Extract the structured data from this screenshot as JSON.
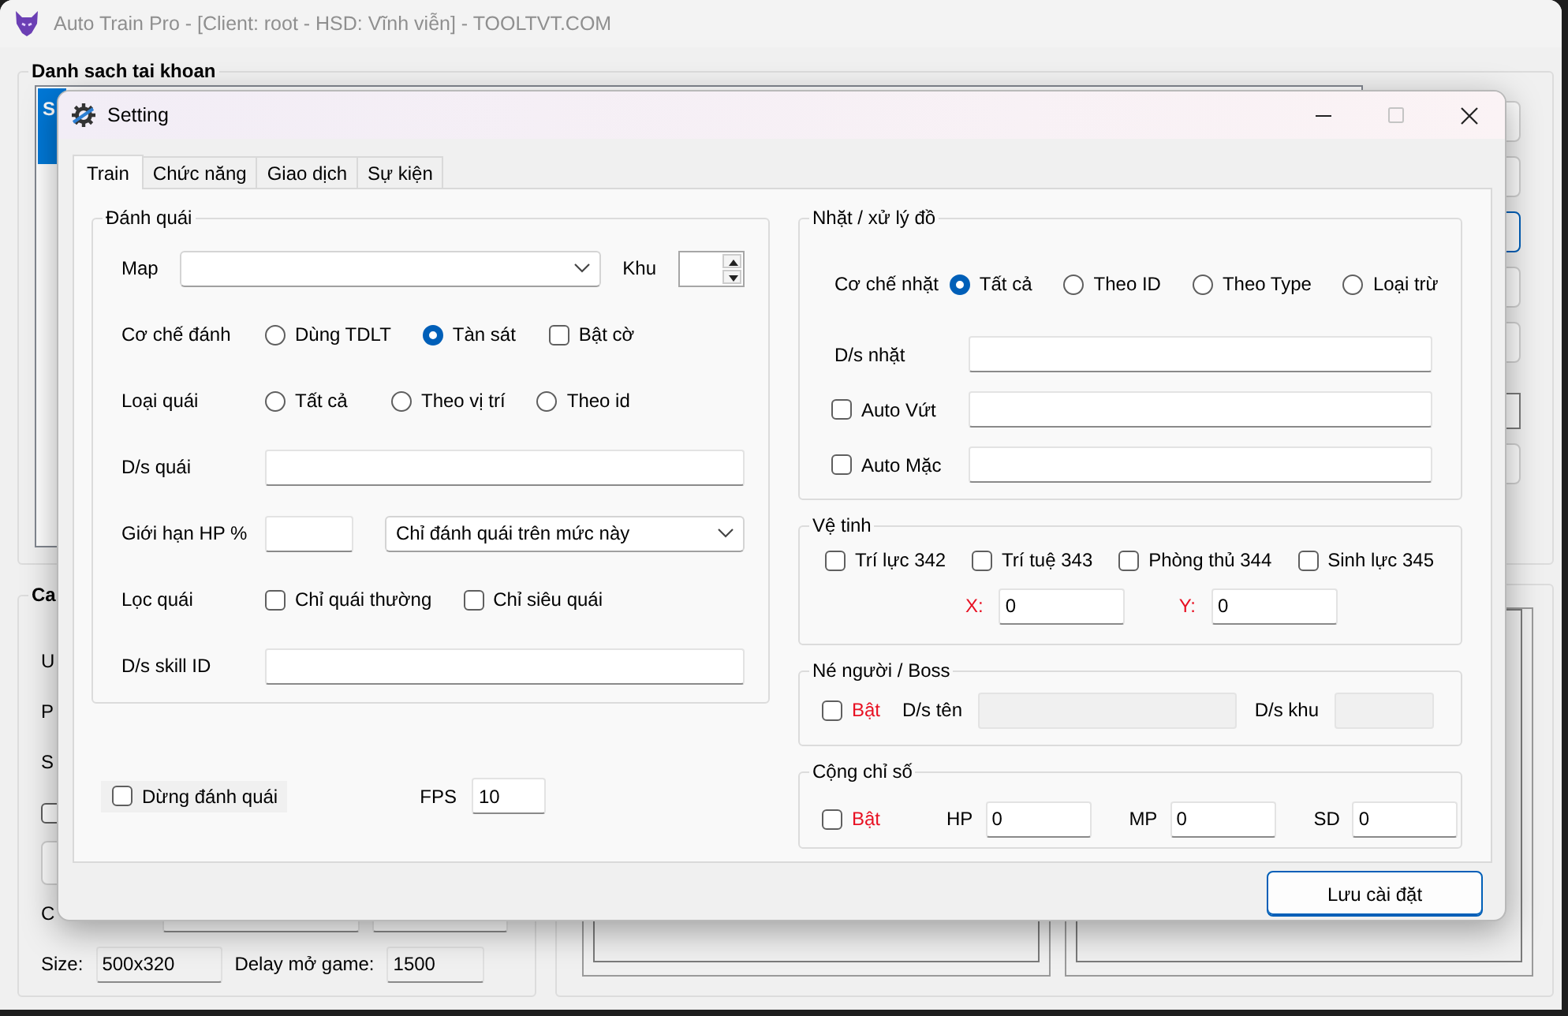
{
  "main_window": {
    "title": "Auto Train Pro - [Client: root - HSD: Vĩnh viễn] - TOOLTVT.COM",
    "accounts": {
      "title": "Danh sach tai khoan",
      "list_header": "S"
    },
    "config": {
      "title": "Ca",
      "labels": [
        "U",
        "P",
        "S",
        "C"
      ],
      "checkbox": {
        "checked": false
      },
      "size_label": "Size:",
      "size_value": "500x320",
      "delay_label": "Delay mở game:",
      "delay_value": "1500"
    }
  },
  "dialog": {
    "title": "Setting",
    "window_buttons": [
      {
        "kind": "minimize",
        "disabled": false
      },
      {
        "kind": "maximize",
        "disabled": true
      },
      {
        "kind": "close",
        "disabled": false
      }
    ],
    "tabs": [
      {
        "label": "Train",
        "selected": true
      },
      {
        "label": "Chức năng",
        "selected": false
      },
      {
        "label": "Giao dịch",
        "selected": false
      },
      {
        "label": "Sự kiện",
        "selected": false
      }
    ],
    "attack": {
      "title": "Đánh quái",
      "rows": [
        {
          "kind": "map",
          "label": "Map",
          "zone_label": "Khu"
        },
        {
          "kind": "choices",
          "label": "Cơ chế đánh",
          "items": [
            {
              "kind": "radio",
              "label": "Dùng TDLT",
              "selected": false
            },
            {
              "kind": "radio",
              "label": "Tàn sát",
              "selected": true
            },
            {
              "kind": "checkbox",
              "label": "Bật cờ",
              "checked": false
            }
          ]
        },
        {
          "kind": "choices",
          "label": "Loại quái",
          "items": [
            {
              "kind": "radio",
              "label": "Tất cả",
              "selected": false
            },
            {
              "kind": "radio",
              "label": "Theo vị trí",
              "selected": false
            },
            {
              "kind": "radio",
              "label": "Theo id",
              "selected": false
            }
          ]
        },
        {
          "kind": "text",
          "label": "D/s quái"
        },
        {
          "kind": "hp",
          "label": "Giới hạn HP %",
          "value": "Chỉ đánh quái trên mức này"
        },
        {
          "kind": "choices",
          "label": "Lọc quái",
          "items": [
            {
              "kind": "checkbox",
              "label": "Chỉ quái thường",
              "checked": false
            },
            {
              "kind": "checkbox",
              "label": "Chỉ siêu quái",
              "checked": false
            }
          ]
        },
        {
          "kind": "text",
          "label": "D/s skill ID"
        }
      ]
    },
    "stop_attack": {
      "label": "Dừng đánh quái",
      "checked": false
    },
    "fps": {
      "label": "FPS",
      "value": "10"
    },
    "pickup": {
      "title": "Nhặt / xử lý đồ",
      "mode_label": "Cơ chế nhặt",
      "modes": [
        {
          "label": "Tất cả",
          "selected": true
        },
        {
          "label": "Theo ID",
          "selected": false
        },
        {
          "label": "Theo Type",
          "selected": false
        },
        {
          "label": "Loại trừ",
          "selected": false
        }
      ],
      "list_label": "D/s nhặt",
      "drop": {
        "label": "Auto Vứt",
        "checked": false
      },
      "equip": {
        "label": "Auto Mặc",
        "checked": false
      }
    },
    "satellite": {
      "title": "Vệ tinh",
      "options": [
        {
          "label": "Trí lực 342",
          "checked": false
        },
        {
          "label": "Trí tuệ 343",
          "checked": false
        },
        {
          "label": "Phòng thủ 344",
          "checked": false
        },
        {
          "label": "Sinh lực 345",
          "checked": false
        }
      ],
      "x_label": "X:",
      "x_value": "0",
      "y_label": "Y:",
      "y_value": "0"
    },
    "avoid": {
      "title": "Né người / Boss",
      "enable": {
        "label": "Bật",
        "checked": false
      },
      "names": {
        "label": "D/s tên",
        "disabled": true
      },
      "zones": {
        "label": "D/s khu",
        "disabled": true
      }
    },
    "stats": {
      "title": "Cộng chỉ số",
      "enable": {
        "label": "Bật",
        "checked": false
      },
      "fields": [
        {
          "label": "HP",
          "value": "0"
        },
        {
          "label": "MP",
          "value": "0"
        },
        {
          "label": "SD",
          "value": "0"
        }
      ]
    },
    "save_button": "Lưu cài đặt"
  }
}
